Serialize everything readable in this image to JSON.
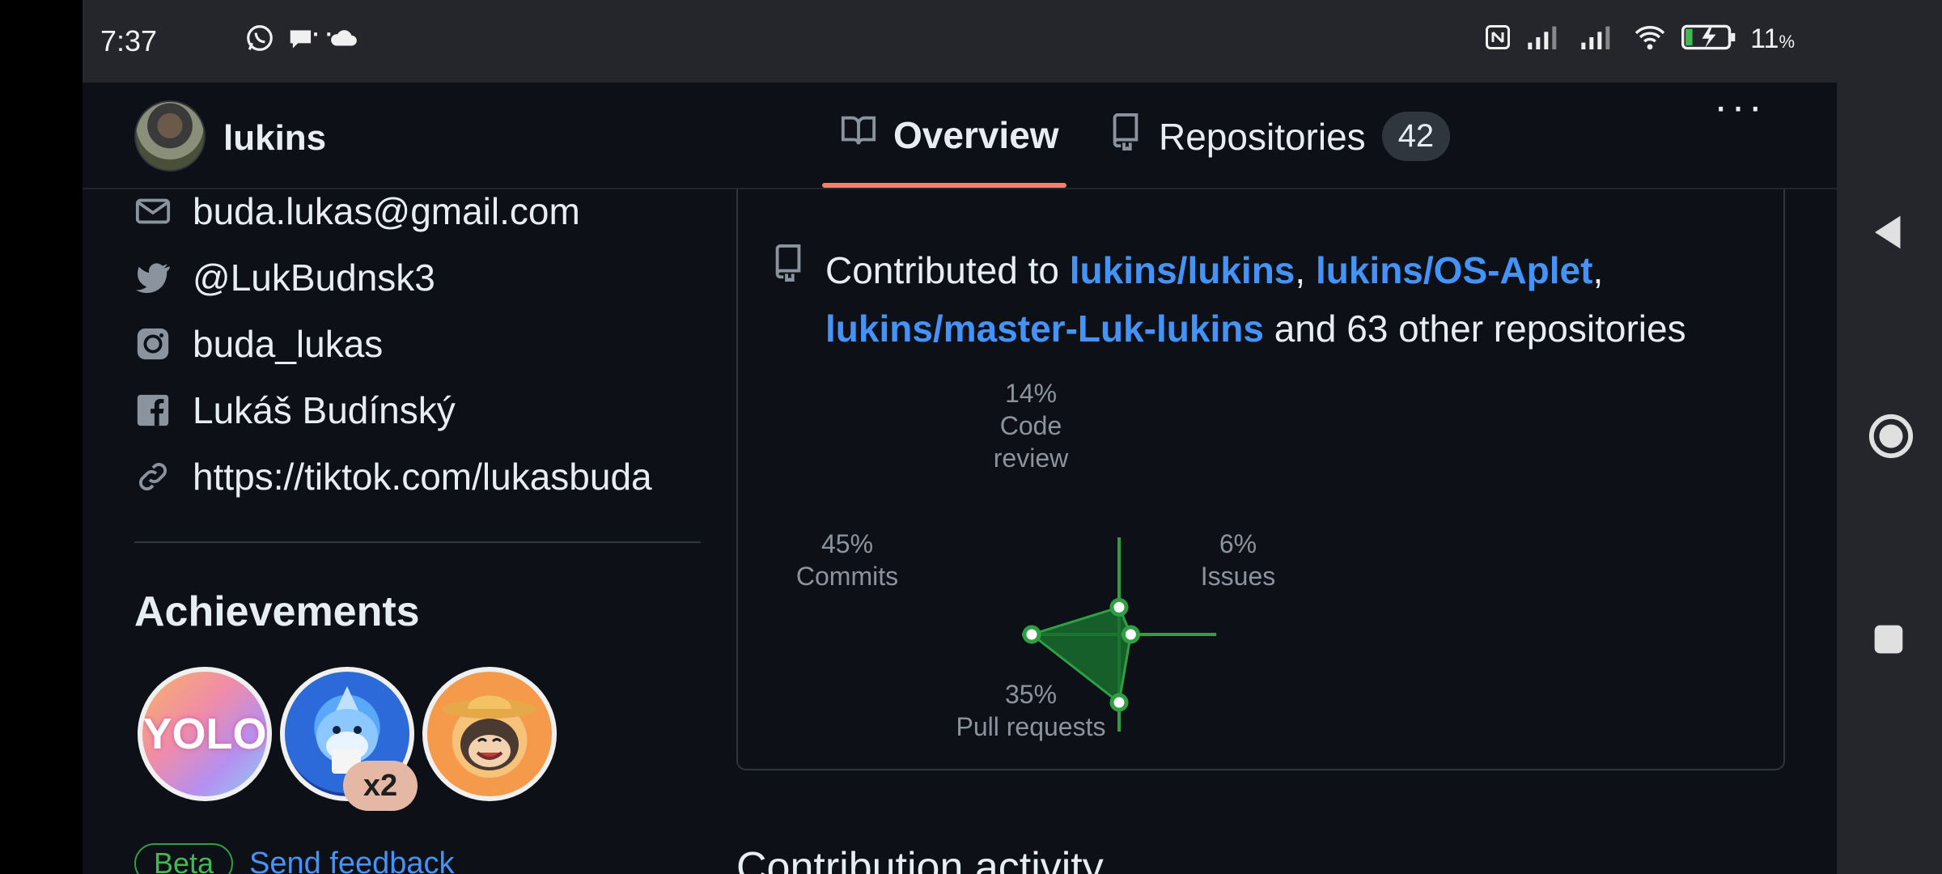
{
  "status_bar": {
    "time": "7:37",
    "left_icons": [
      "whatsapp-icon",
      "chat-bubble-icon",
      "cloud-icon"
    ],
    "more": "···",
    "battery_percent": "11",
    "battery_unit": "%",
    "right_icons": [
      "nfc-icon",
      "signal-icon",
      "signal-icon",
      "wifi-icon",
      "battery-charging-icon"
    ]
  },
  "header": {
    "username": "lukins",
    "tabs": [
      {
        "label": "Overview",
        "icon": "book-icon",
        "active": true
      },
      {
        "label": "Repositories",
        "icon": "repo-icon",
        "count": "42",
        "active": false
      }
    ],
    "menu": "···"
  },
  "profile": {
    "contacts": [
      {
        "icon": "mail-icon",
        "text": "buda.lukas@gmail.com"
      },
      {
        "icon": "twitter-icon",
        "text": "@LukBudnsk3"
      },
      {
        "icon": "instagram-icon",
        "text": "buda_lukas"
      },
      {
        "icon": "facebook-icon",
        "text": "Lukáš Budínský"
      },
      {
        "icon": "link-icon",
        "text": "https://tiktok.com/lukasbuda"
      }
    ],
    "achievements_title": "Achievements",
    "badges": [
      {
        "name": "yolo-badge",
        "text": "YOLO"
      },
      {
        "name": "shark-badge",
        "multiplier": "x2"
      },
      {
        "name": "cowboy-badge"
      }
    ],
    "beta_label": "Beta",
    "feedback_link": "Send feedback"
  },
  "activity": {
    "contrib_prefix": "Contributed to ",
    "repos": [
      "lukins/lukins",
      "lukins/OS-Aplet",
      "lukins/master-Luk-lukins"
    ],
    "sep1": ", ",
    "sep2": ",",
    "contrib_suffix": " and 63 other repositories",
    "section_title": "Contribution activity"
  },
  "chart_data": {
    "type": "radar",
    "axes": [
      {
        "label": "Code review",
        "percent": 14,
        "value_text": "14%",
        "direction": "top"
      },
      {
        "label": "Issues",
        "percent": 6,
        "value_text": "6%",
        "direction": "right"
      },
      {
        "label": "Pull requests",
        "percent": 35,
        "value_text": "35%",
        "direction": "bottom"
      },
      {
        "label": "Commits",
        "percent": 45,
        "value_text": "45%",
        "direction": "left"
      }
    ],
    "color": "#2ea043",
    "fill_color": "#196c2e"
  },
  "colors": {
    "background": "#0d1117",
    "link": "#4493f8",
    "tab_underline": "#f78166",
    "text_muted": "#8b949e"
  }
}
